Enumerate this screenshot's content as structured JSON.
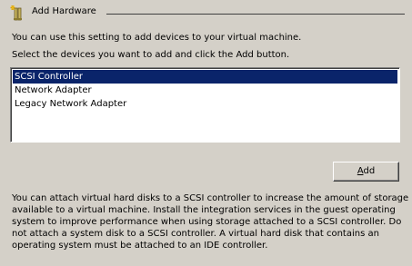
{
  "header": {
    "title": "Add Hardware",
    "icon": "hardware-add-icon"
  },
  "intro_text": "You can use this setting to add devices to your virtual machine.",
  "select_label": "Select the devices you want to add and click the Add button.",
  "device_list": {
    "items": [
      {
        "label": "SCSI Controller",
        "selected": true
      },
      {
        "label": "Network Adapter",
        "selected": false
      },
      {
        "label": "Legacy Network Adapter",
        "selected": false
      }
    ]
  },
  "add_button": {
    "mnemonic": "A",
    "rest": "dd"
  },
  "description_lines": [
    "You can attach virtual hard disks to a SCSI controller to increase the amount of storage",
    "available to a virtual machine. Install the integration services in the guest operating",
    "system to improve performance when using storage attached to a SCSI controller. Do",
    "not attach a system disk to a SCSI controller. A virtual hard disk that contains an",
    "operating system must be attached to an IDE controller."
  ],
  "colors": {
    "background": "#d4d0c8",
    "selection": "#0a246a",
    "selection_text": "#ffffff"
  }
}
